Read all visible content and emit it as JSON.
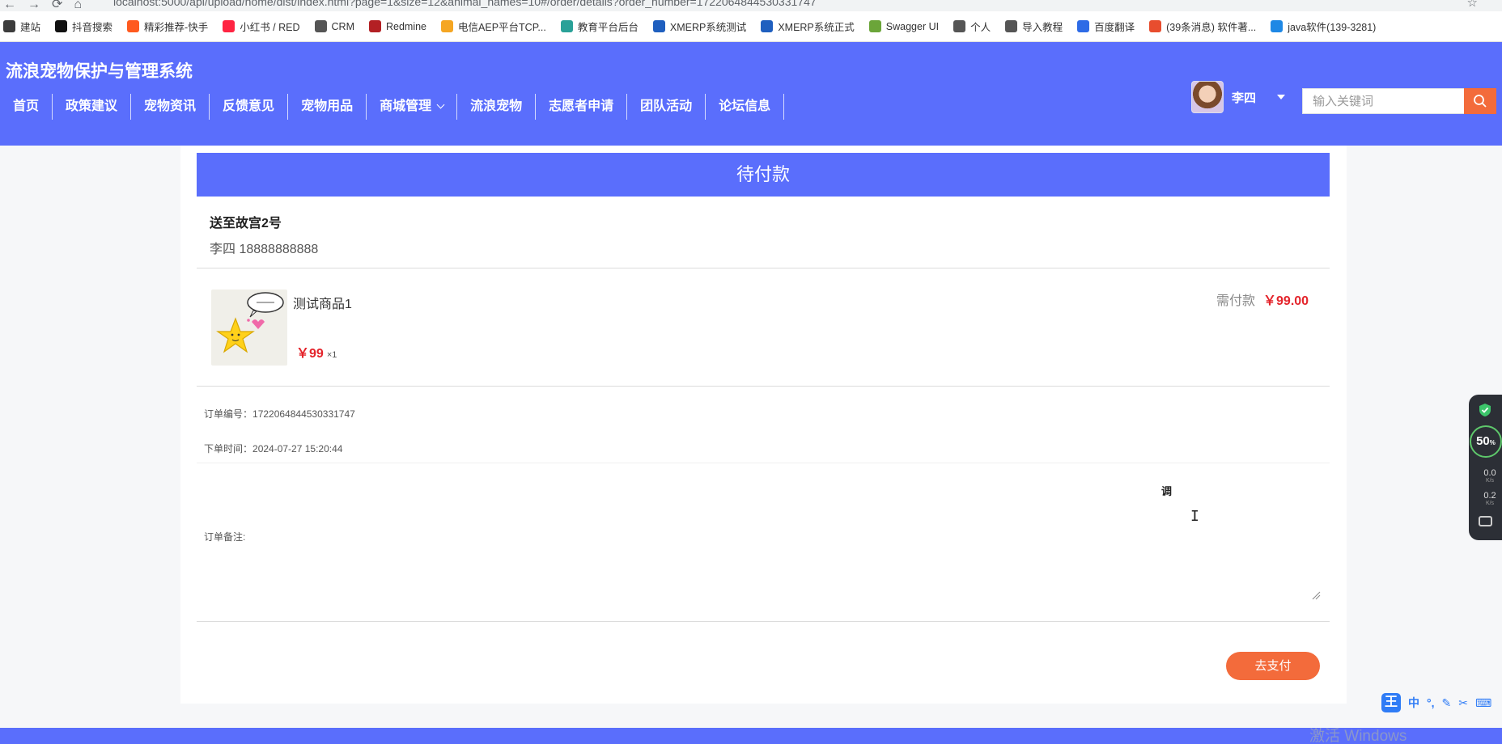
{
  "browser": {
    "url": "localhost:5000/api/upload/home/dist/index.html?page=1&size=12&animal_names=10#/order/details?order_number=1722064844530331747",
    "bookmarks": [
      {
        "label": "建站",
        "color": "#3c3c3c"
      },
      {
        "label": "抖音搜索",
        "color": "#111111"
      },
      {
        "label": "精彩推荐-快手",
        "color": "#ff5a1f"
      },
      {
        "label": "小红书 / RED",
        "color": "#ff2442"
      },
      {
        "label": "CRM",
        "color": "#555555"
      },
      {
        "label": "Redmine",
        "color": "#b32024"
      },
      {
        "label": "电信AEP平台TCP...",
        "color": "#f5a623"
      },
      {
        "label": "教育平台后台",
        "color": "#2aa198"
      },
      {
        "label": "XMERP系统测试",
        "color": "#1f5fbf"
      },
      {
        "label": "XMERP系统正式",
        "color": "#1f5fbf"
      },
      {
        "label": "Swagger UI",
        "color": "#6ba539"
      },
      {
        "label": "个人",
        "color": "#555555"
      },
      {
        "label": "导入教程",
        "color": "#555555"
      },
      {
        "label": "百度翻译",
        "color": "#2e6be6"
      },
      {
        "label": "(39条消息) 软件著...",
        "color": "#e84d2e"
      },
      {
        "label": "java软件(139-3281)",
        "color": "#1e88e5"
      }
    ]
  },
  "header": {
    "site_title": "流浪宠物保护与管理系统",
    "nav": [
      "首页",
      "政策建议",
      "宠物资讯",
      "反馈意见",
      "宠物用品",
      "商城管理",
      "流浪宠物",
      "志愿者申请",
      "团队活动",
      "论坛信息"
    ],
    "user_name": "李四",
    "search_placeholder": "输入关键词"
  },
  "order": {
    "status": "待付款",
    "address": "送至故宫2号",
    "contact": "李四 18888888888",
    "goods": {
      "name": "测试商品1",
      "price": "￥99",
      "qty": "×1"
    },
    "need_pay_label": "需付款",
    "need_pay_amount": "￥99.00",
    "order_number_label": "订单编号：",
    "order_number": "1722064844530331747",
    "order_time_label": "下单时间：",
    "order_time": "2024-07-27 15:20:44",
    "remark_label": "订单备注:",
    "remark_ime_text": "调",
    "pay_button": "去支付"
  },
  "widgets": {
    "speed_percent": "50",
    "speed_percent_unit": "%",
    "up_rate": "0.0",
    "down_rate": "0.2",
    "rate_unit": "K/s",
    "ime_items": [
      "中",
      "°,",
      "✎",
      "✂",
      "⌨"
    ],
    "watermark": "激活 Windows"
  },
  "colors": {
    "primary": "#5a6efc",
    "accent": "#f36b3b",
    "price_red": "#e4242b"
  }
}
